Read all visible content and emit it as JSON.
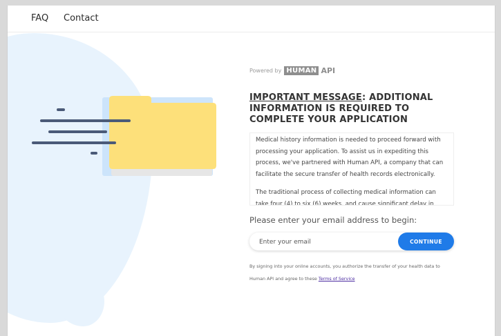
{
  "nav": {
    "faq": "FAQ",
    "contact": "Contact"
  },
  "powered": {
    "prefix": "Powered by",
    "brand_box": "HUMAN",
    "brand_suffix": "API"
  },
  "headline": {
    "underlined": "IMPORTANT MESSAGE",
    "rest": ": ADDITIONAL INFORMATION IS REQUIRED TO COMPLETE YOUR APPLICATION"
  },
  "message": {
    "paragraph1": "Medical history information is needed to proceed forward with processing your application. To assist us in expediting this process, we've partnered with Human API, a company that can facilitate the secure transfer of health records electronically.",
    "paragraph2": "The traditional process of collecting medical information can take four (4) to six (6) weeks, and cause significant delay in approving your application."
  },
  "form": {
    "prompt": "Please enter your email address to begin:",
    "email_placeholder": "Enter your email",
    "email_value": "",
    "continue_label": "CONTINUE"
  },
  "legal": {
    "text": "By signing into your online accounts, you authorize the transfer of your health data to Human API and agree to these",
    "link": "Terms of Service"
  },
  "colors": {
    "accent": "#1f7be8",
    "blob": "#e8f3fd",
    "folder": "#fde07a",
    "speed_lines": "#4a5a78"
  }
}
